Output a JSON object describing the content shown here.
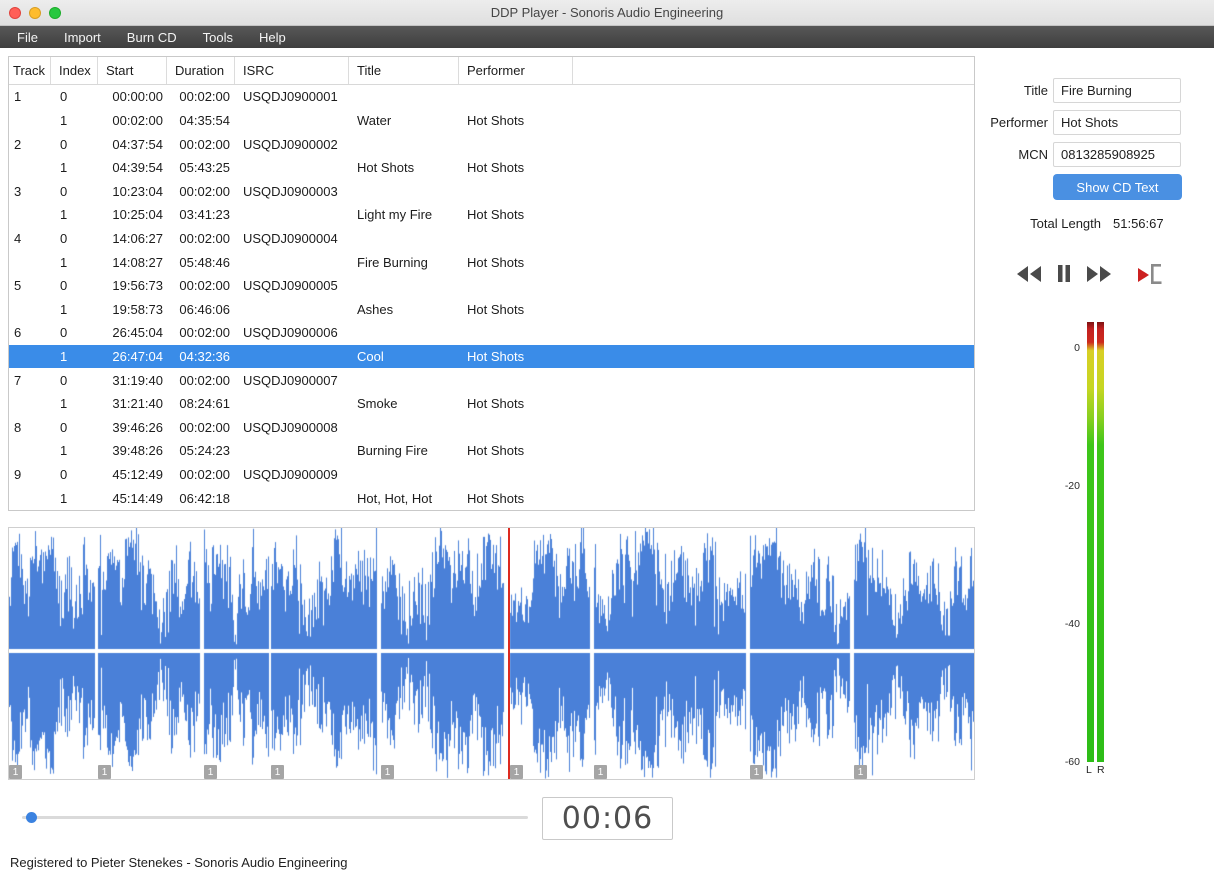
{
  "colors": {
    "accent": "#4a90e2",
    "selection": "#3a8ce8",
    "waveform": "#4a80d8",
    "playhead": "#dd2a20"
  },
  "window": {
    "title": "DDP Player - Sonoris Audio Engineering"
  },
  "menu": {
    "items": [
      "File",
      "Import",
      "Burn CD",
      "Tools",
      "Help"
    ]
  },
  "table": {
    "columns": [
      "Track",
      "Index",
      "Start",
      "Duration",
      "ISRC",
      "Title",
      "Performer"
    ],
    "rows": [
      {
        "track": "1",
        "index": "0",
        "start": "00:00:00",
        "duration": "00:02:00",
        "isrc": "USQDJ0900001",
        "title": "",
        "performer": "",
        "selected": false
      },
      {
        "track": "",
        "index": "1",
        "start": "00:02:00",
        "duration": "04:35:54",
        "isrc": "",
        "title": "Water",
        "performer": "Hot Shots",
        "selected": false
      },
      {
        "track": "2",
        "index": "0",
        "start": "04:37:54",
        "duration": "00:02:00",
        "isrc": "USQDJ0900002",
        "title": "",
        "performer": "",
        "selected": false
      },
      {
        "track": "",
        "index": "1",
        "start": "04:39:54",
        "duration": "05:43:25",
        "isrc": "",
        "title": "Hot Shots",
        "performer": "Hot Shots",
        "selected": false
      },
      {
        "track": "3",
        "index": "0",
        "start": "10:23:04",
        "duration": "00:02:00",
        "isrc": "USQDJ0900003",
        "title": "",
        "performer": "",
        "selected": false
      },
      {
        "track": "",
        "index": "1",
        "start": "10:25:04",
        "duration": "03:41:23",
        "isrc": "",
        "title": "Light my Fire",
        "performer": "Hot Shots",
        "selected": false
      },
      {
        "track": "4",
        "index": "0",
        "start": "14:06:27",
        "duration": "00:02:00",
        "isrc": "USQDJ0900004",
        "title": "",
        "performer": "",
        "selected": false
      },
      {
        "track": "",
        "index": "1",
        "start": "14:08:27",
        "duration": "05:48:46",
        "isrc": "",
        "title": "Fire Burning",
        "performer": "Hot Shots",
        "selected": false
      },
      {
        "track": "5",
        "index": "0",
        "start": "19:56:73",
        "duration": "00:02:00",
        "isrc": "USQDJ0900005",
        "title": "",
        "performer": "",
        "selected": false
      },
      {
        "track": "",
        "index": "1",
        "start": "19:58:73",
        "duration": "06:46:06",
        "isrc": "",
        "title": "Ashes",
        "performer": "Hot Shots",
        "selected": false
      },
      {
        "track": "6",
        "index": "0",
        "start": "26:45:04",
        "duration": "00:02:00",
        "isrc": "USQDJ0900006",
        "title": "",
        "performer": "",
        "selected": false
      },
      {
        "track": "",
        "index": "1",
        "start": "26:47:04",
        "duration": "04:32:36",
        "isrc": "",
        "title": "Cool",
        "performer": "Hot Shots",
        "selected": true
      },
      {
        "track": "7",
        "index": "0",
        "start": "31:19:40",
        "duration": "00:02:00",
        "isrc": "USQDJ0900007",
        "title": "",
        "performer": "",
        "selected": false
      },
      {
        "track": "",
        "index": "1",
        "start": "31:21:40",
        "duration": "08:24:61",
        "isrc": "",
        "title": "Smoke",
        "performer": "Hot Shots",
        "selected": false
      },
      {
        "track": "8",
        "index": "0",
        "start": "39:46:26",
        "duration": "00:02:00",
        "isrc": "USQDJ0900008",
        "title": "",
        "performer": "",
        "selected": false
      },
      {
        "track": "",
        "index": "1",
        "start": "39:48:26",
        "duration": "05:24:23",
        "isrc": "",
        "title": "Burning Fire",
        "performer": "Hot Shots",
        "selected": false
      },
      {
        "track": "9",
        "index": "0",
        "start": "45:12:49",
        "duration": "00:02:00",
        "isrc": "USQDJ0900009",
        "title": "",
        "performer": "",
        "selected": false
      },
      {
        "track": "",
        "index": "1",
        "start": "45:14:49",
        "duration": "06:42:18",
        "isrc": "",
        "title": "Hot, Hot, Hot",
        "performer": "Hot Shots",
        "selected": false
      }
    ]
  },
  "panel": {
    "title_label": "Title",
    "title_value": "Fire Burning",
    "performer_label": "Performer",
    "performer_value": "Hot Shots",
    "mcn_label": "MCN",
    "mcn_value": "0813285908925",
    "cd_text_button": "Show CD Text",
    "total_length_label": "Total Length",
    "total_length_value": "51:56:67"
  },
  "meter": {
    "ticks": [
      "0",
      "-20",
      "-40",
      "-60"
    ],
    "left_label": "L",
    "right_label": "R"
  },
  "waveform": {
    "marker_label": "1",
    "playhead_fraction": 0.517,
    "segments": [
      {
        "start": 0.0,
        "end": 0.089
      },
      {
        "start": 0.092,
        "end": 0.198
      },
      {
        "start": 0.202,
        "end": 0.269
      },
      {
        "start": 0.272,
        "end": 0.381
      },
      {
        "start": 0.385,
        "end": 0.513
      },
      {
        "start": 0.519,
        "end": 0.602
      },
      {
        "start": 0.606,
        "end": 0.764
      },
      {
        "start": 0.768,
        "end": 0.872
      },
      {
        "start": 0.876,
        "end": 1.0
      }
    ]
  },
  "transport_bar": {
    "time": "00:06"
  },
  "statusbar": {
    "text": "Registered to Pieter Stenekes - Sonoris Audio Engineering"
  }
}
